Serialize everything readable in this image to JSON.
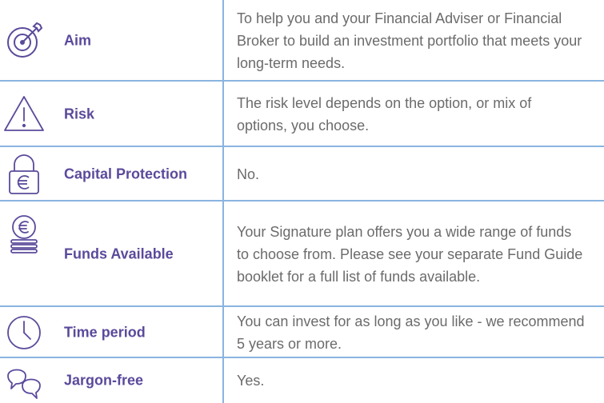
{
  "rows": [
    {
      "icon": "target-icon",
      "label": "Aim",
      "description": "To help you and your Financial Adviser or Financial Broker to build an investment portfolio that meets your long-term needs."
    },
    {
      "icon": "warning-triangle-icon",
      "label": "Risk",
      "description": "The risk level depends on the option, or mix of options, you choose."
    },
    {
      "icon": "euro-padlock-icon",
      "label": "Capital Protection",
      "description": "No."
    },
    {
      "icon": "euro-coin-stack-icon",
      "label": "Funds Available",
      "description": "Your Signature plan offers you a wide range of funds to choose from. Please see your separate Fund Guide booklet for a full list of funds available."
    },
    {
      "icon": "clock-icon",
      "label": "Time period",
      "description": "You can invest for as long as you like - we recommend  5 years or more."
    },
    {
      "icon": "speech-bubbles-icon",
      "label": "Jargon-free",
      "description": "Yes."
    }
  ],
  "colors": {
    "label": "#5b4a9b",
    "text": "#6b6b6b",
    "border": "#8ab4e0",
    "icon": "#5b4a9b"
  }
}
